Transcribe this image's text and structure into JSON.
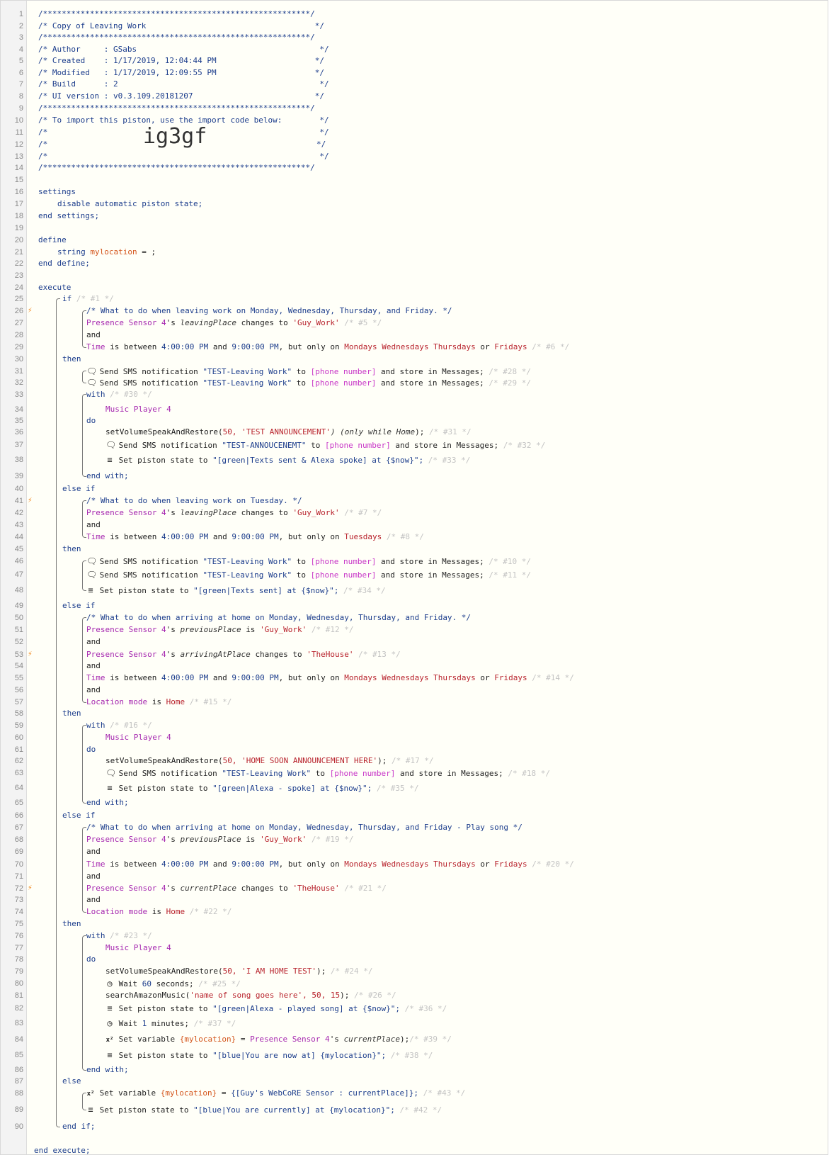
{
  "header": {
    "border": "/*********************************************************/",
    "title": "/* Copy of Leaving Work                                    */",
    "author": "/* Author     : GSabs                                       */",
    "created": "/* Created    : 1/17/2019, 12:04:44 PM                     */",
    "modified": "/* Modified   : 1/17/2019, 12:09:55 PM                     */",
    "build": "/* Build      : 2                                           */",
    "ui_version": "/* UI version : v0.3.109.20181207                          */",
    "import_note": "/* To import this piston, use the import code below:        */",
    "blank": "/*                                                          */",
    "blank_left": "/*",
    "blank_right": "*/",
    "import_code": "ig3gf"
  },
  "code": {
    "settings_kw": "settings",
    "disable_state": "disable automatic piston state;",
    "end_settings": "end settings;",
    "define_kw": "define",
    "string_kw": "string",
    "var_name": "mylocation",
    "assign_empty": " = ;",
    "end_define": "end define;",
    "execute_kw": "execute",
    "if_kw": "if",
    "then_kw": "then",
    "else_if_kw": "else if",
    "else_kw": "else",
    "end_if": "end if;",
    "and_kw": "and",
    "with_kw": "with",
    "do_kw": "do",
    "end_with": "end with;",
    "presence_sensor": "Presence Sensor 4",
    "music_player": "Music Player 4",
    "time": "Time",
    "location_mode": "Location mode",
    "is": "is",
    "s": "'s",
    "changes_to": "changes to",
    "is_between": "is between",
    "pm4": "4:00:00 PM",
    "pm9": "9:00:00 PM",
    "but_only_on": ", but only on",
    "mondays": "Mondays",
    "wednesdays": "Wednesdays",
    "thursdays": "Thursdays",
    "fridays": "Fridays",
    "tuesdays": "Tuesdays",
    "or": "or",
    "home": "Home",
    "guy_work": "'Guy_Work'",
    "the_house": "'TheHouse'",
    "leaving_place": "leavingPlace",
    "previous_place": "previousPlace",
    "arriving_at_place": "arrivingAtPlace",
    "current_place": "currentPlace",
    "send_sms": "Send SMS notification",
    "to": "to",
    "phone_number": "[phone number]",
    "store_messages": "and store in Messages;",
    "test_leaving_work": "\"TEST-Leaving Work\"",
    "test_announcement_sms": "\"TEST-ANNOUCENEMT\"",
    "set_state": "Set piston state to",
    "set_variable": "Set variable",
    "wait": "Wait",
    "seconds": "seconds;",
    "minutes": "minutes;",
    "svsr": "setVolumeSpeakAndRestore(",
    "sam": "searchAmazonMusic(",
    "comments": {
      "c26": "/* What to do when leaving work on Monday, Wednesday, Thursday, and Friday. */",
      "c41": "/* What to do when leaving work on Tuesday. */",
      "c50": "/* What to do when arriving at home on Monday, Wednesday, Thursday, and Friday. */",
      "c67": "/* What to do when arriving at home on Monday, Wednesday, Thursday, and Friday - Play song */"
    },
    "ids": {
      "i1": "/* #1 */",
      "i5": "/* #5 */",
      "i6": "/* #6 */",
      "i28": "/* #28 */",
      "i29": "/* #29 */",
      "i30": "/* #30 */",
      "i31": "/* #31 */",
      "i32": "/* #32 */",
      "i33": "/* #33 */",
      "i7": "/* #7 */",
      "i8": "/* #8 */",
      "i10": "/* #10 */",
      "i11": "/* #11 */",
      "i34": "/* #34 */",
      "i12": "/* #12 */",
      "i13": "/* #13 */",
      "i14": "/* #14 */",
      "i15": "/* #15 */",
      "i16": "/* #16 */",
      "i17": "/* #17 */",
      "i18": "/* #18 */",
      "i35": "/* #35 */",
      "i19": "/* #19 */",
      "i20": "/* #20 */",
      "i21": "/* #21 */",
      "i22": "/* #22 */",
      "i23": "/* #23 */",
      "i24": "/* #24 */",
      "i25": "/* #25 */",
      "i26": "/* #26 */",
      "i36": "/* #36 */",
      "i37": "/* #37 */",
      "i39": "/* #39 */",
      "i38": "/* #38 */",
      "i43": "/* #43 */",
      "i42": "/* #42 */"
    },
    "l36_args": "50, 'TEST ANNOUNCEMENT'",
    "l36_rest": ") (only while",
    "l36_end": ");",
    "l38_state": "\"[green|Texts sent & Alexa spoke] at {$now}\";",
    "l48_state": "\"[green|Texts sent] at {$now}\";",
    "l62_args": "50, 'HOME SOON ANNOUNCEMENT HERE'",
    "close_semi": ");",
    "l64_state": "\"[green|Alexa - spoke] at {$now}\";",
    "l79_args": "50, 'I AM HOME TEST'",
    "wait60": "60",
    "l81_args": "'name of song goes here', 50, 15",
    "l82_state": "\"[green|Alexa - played song] at {$now}\";",
    "wait1": "1",
    "mylocation_ref": "{mylocation}",
    "equals": "=",
    "l85_state": "\"[blue|You are now at] {mylocation}\";",
    "l88_value": "{[Guy's WebCoRE Sensor : currentPlace]};",
    "l89_state": "\"[blue|You are currently] at {mylocation}\";",
    "end_execute_cut": "end execute;"
  },
  "icons": {
    "speech": "speech-bubble-icon",
    "list": "list-icon",
    "clock": "clock-icon",
    "x2": "variable-icon",
    "flash": "flash-icon"
  }
}
